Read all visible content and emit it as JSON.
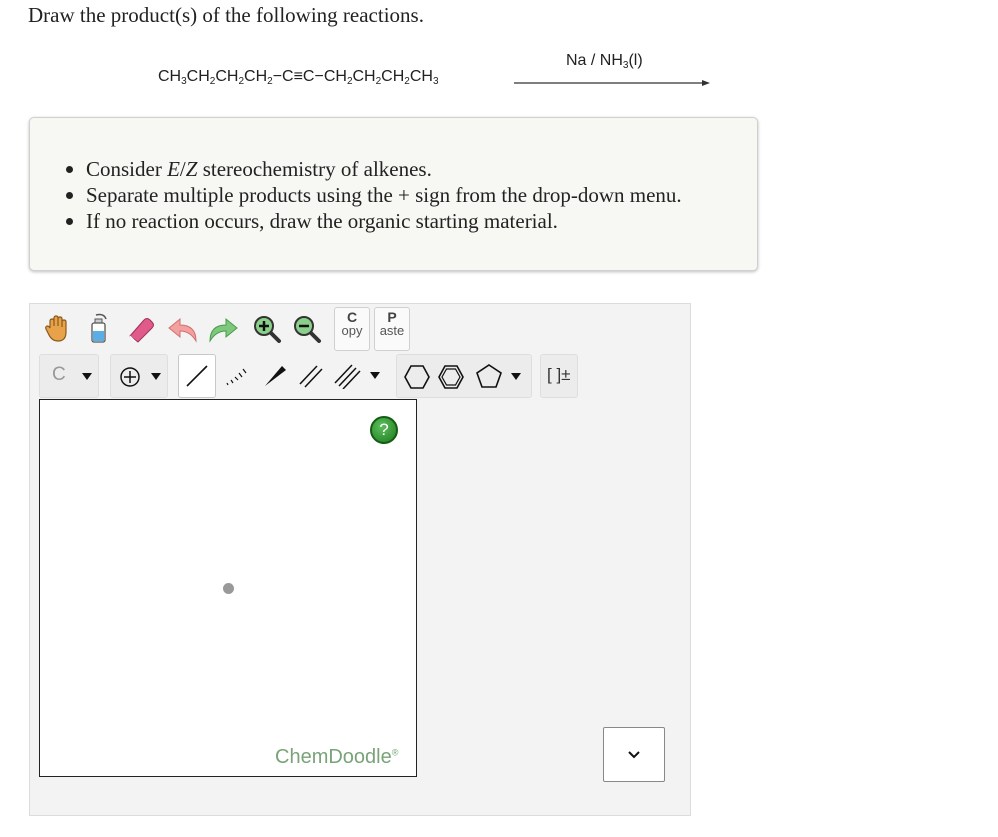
{
  "question": {
    "title": "Draw the product(s) of the following reactions."
  },
  "reaction": {
    "reactant_parts": [
      "CH",
      "3",
      "CH",
      "2",
      "CH",
      "2",
      "CH",
      "2",
      "−C≡C−CH",
      "2",
      "CH",
      "2",
      "CH",
      "2",
      "CH",
      "3"
    ],
    "reagent_parts": [
      "Na / NH",
      "3",
      "(l)"
    ]
  },
  "hints": {
    "item1_pre": "Consider ",
    "item1_e": "E",
    "item1_slash": "/",
    "item1_z": "Z",
    "item1_post": " stereochemistry of alkenes.",
    "item2": "Separate multiple products using the + sign from the drop-down menu.",
    "item3": "If no reaction occurs, draw the organic starting material."
  },
  "toolbar": {
    "copy_big": "C",
    "copy_small": "opy",
    "paste_big": "P",
    "paste_small": "aste",
    "element_label": "C",
    "bracket_label": "[ ]±"
  },
  "canvas": {
    "help_label": "?",
    "watermark": "ChemDoodle",
    "watermark_mark": "®"
  },
  "icons": [
    "hand-icon",
    "lasso-bottle-icon",
    "eraser-icon",
    "undo-icon",
    "redo-icon",
    "zoom-in-icon",
    "zoom-out-icon",
    "charge-plus-icon",
    "single-bond-icon",
    "hash-bond-icon",
    "wedge-bond-icon",
    "double-bond-icon",
    "triple-bond-icon",
    "cyclohexane-icon",
    "benzene-icon",
    "cyclopentane-icon",
    "chevron-down-icon"
  ],
  "colors": {
    "help_green": "#1d7a1d",
    "watermark_green": "#7aa37a",
    "eraser_pink": "#e05a8a",
    "undo_pink": "#f2a0a0",
    "redo_green": "#7ec87e"
  }
}
